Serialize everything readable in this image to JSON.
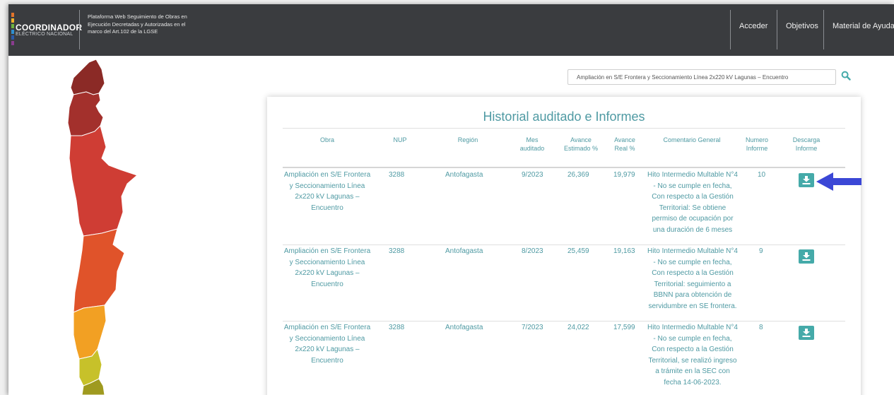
{
  "header": {
    "logo_line1": "COORDINADOR",
    "logo_line2": "ELÉCTRICO NACIONAL",
    "platform_text": "Plataforma Web Seguimiento de Obras en Ejecución Decretadas y Autorizadas en el marco del Art.102 de la LGSE",
    "nav": [
      "Acceder",
      "Objetivos",
      "Material de Ayuda"
    ]
  },
  "search": {
    "value": "Ampliación en S/E Frontera y Seccionamiento Línea 2x220 kV Lagunas – Encuentro",
    "icon": "search-icon"
  },
  "map": {
    "region_colors": [
      "#8b2a26",
      "#a3302c",
      "#cf3d34",
      "#e0532a",
      "#ea6a26",
      "#f2a023",
      "#c7c12a",
      "#9f9a1f"
    ]
  },
  "panel": {
    "title": "Historial auditado e Informes",
    "headers": {
      "obra": "Obra",
      "nup": "NUP",
      "region": "Región",
      "mes": "Mes auditado",
      "estimado": "Avance Estimado %",
      "real": "Avance Real %",
      "comentario": "Comentario General",
      "numero": "Numero Informe",
      "descarga": "Descarga Informe"
    },
    "rows": [
      {
        "obra": "Ampliación en S/E Frontera y Seccionamiento Línea 2x220 kV Lagunas – Encuentro",
        "nup": "3288",
        "region": "Antofagasta",
        "mes": "9/2023",
        "estimado": "26,369",
        "real": "19,979",
        "comentario": "Hito Intermedio Multable N°4 - No se cumple en fecha, Con respecto a la Gestión Territorial: Se obtiene permiso de ocupación por una duración de 6 meses",
        "numero": "10"
      },
      {
        "obra": "Ampliación en S/E Frontera y Seccionamiento Línea 2x220 kV Lagunas – Encuentro",
        "nup": "3288",
        "region": "Antofagasta",
        "mes": "8/2023",
        "estimado": "25,459",
        "real": "19,163",
        "comentario": "Hito Intermedio Multable N°4 - No se cumple en fecha, Con respecto a la Gestión Territorial: seguimiento a BBNN para obtención de servidumbre en SE frontera.",
        "numero": "9"
      },
      {
        "obra": "Ampliación en S/E Frontera y Seccionamiento Línea 2x220 kV Lagunas – Encuentro",
        "nup": "3288",
        "region": "Antofagasta",
        "mes": "7/2023",
        "estimado": "24,022",
        "real": "17,599",
        "comentario": "Hito Intermedio Multable N°4 - No se cumple en fecha, Con respecto a la Gestión Territorial, se realizó ingreso a trámite en la SEC con fecha 14-06-2023.",
        "numero": "8"
      }
    ],
    "download_icon": "download-icon"
  },
  "colors": {
    "topbar": "#3a3c3f",
    "accent": "#4f9aa3",
    "button": "#45aaa9",
    "arrow": "#3b47d6"
  }
}
